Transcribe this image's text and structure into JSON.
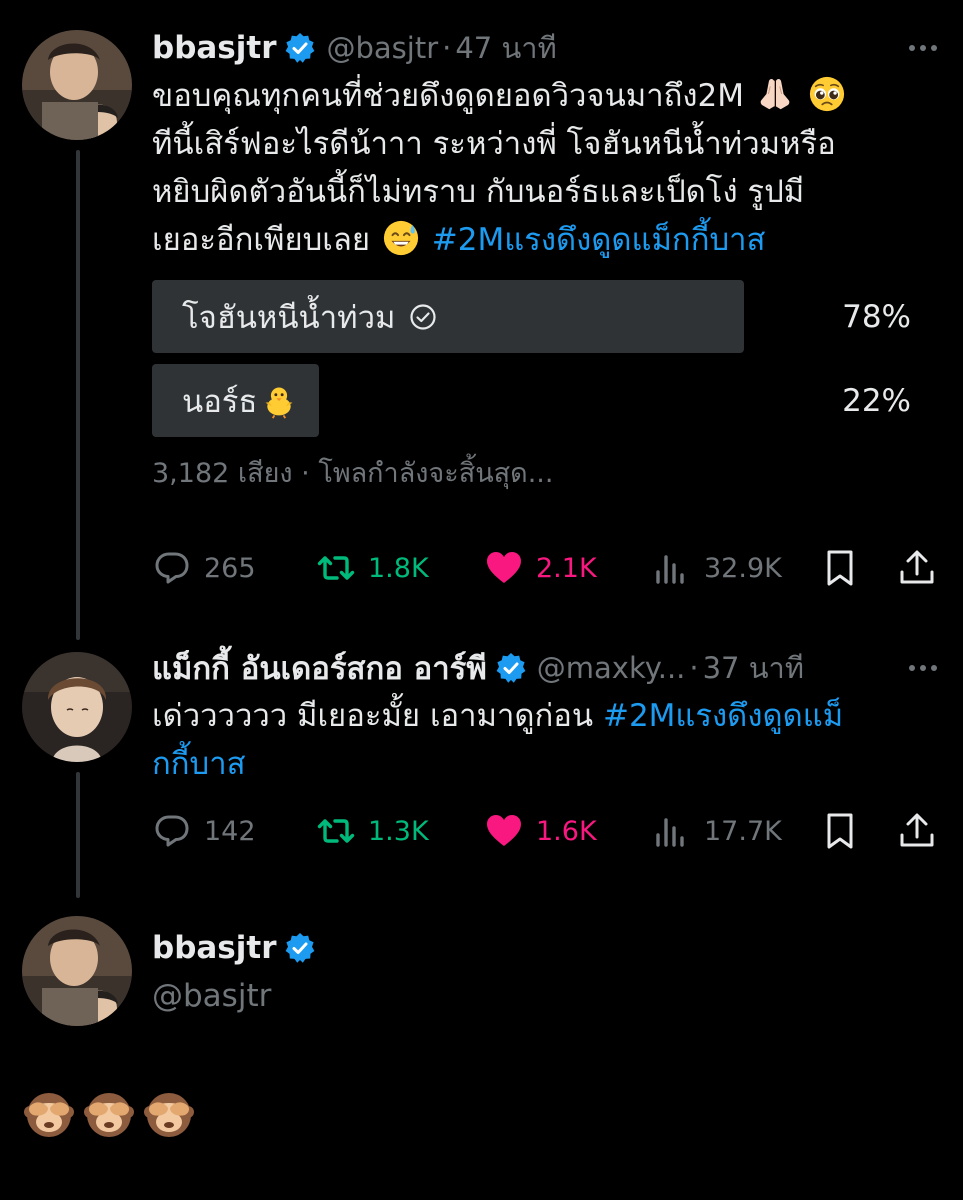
{
  "colors": {
    "background": "#000000",
    "text": "#e7e9ea",
    "muted": "#71767b",
    "link": "#1d9bf0",
    "retweet": "#00ba7c",
    "like": "#f91880",
    "poll_bar": "#2f3336"
  },
  "tweet1": {
    "name": "bbasjtr",
    "handle": "@basjtr",
    "separator": "·",
    "time": "47 นาที",
    "line1": "ขอบคุณทุกคนที่ช่วยดึงดูดยอดวิวจนมาถึง2M",
    "line2": "ทีนี้เสิร์ฟอะไรดีน้าาา ระหว่างพี่ โจฮันหนีน้ำท่วมหรือ",
    "line3": "หยิบผิดตัวอันนี้ก็ไม่ทราบ กับนอร์ธและเป็ดโง่ รูปมี",
    "line4": "เยอะอีกเพียบเลย",
    "hashtag": "#2Mแรงดึงดูดแม็กกี้บาส",
    "emojis": [
      "folded-hands-icon",
      "pleading-face-icon",
      "sweat-smile-icon"
    ],
    "poll": {
      "options": [
        {
          "label": "โจฮันหนีน้ำท่วม",
          "percent": "78%",
          "fraction": 0.78,
          "winner": true,
          "icon": "check-circle-icon"
        },
        {
          "label": "นอร์ธ",
          "percent": "22%",
          "fraction": 0.22,
          "winner": false,
          "icon": "baby-chick-icon"
        }
      ],
      "meta": "3,182 เสียง · โพลกำลังจะสิ้นสุด..."
    },
    "stats": {
      "replies": "265",
      "retweets": "1.8K",
      "likes": "2.1K",
      "views": "32.9K"
    }
  },
  "tweet2": {
    "name": "แม็กกี้ อันเดอร์สกอ อาร์พี",
    "handle": "@maxky...",
    "separator": "·",
    "time": "37 นาที",
    "line1_text": "เด่วววววว มีเยอะมั้ย เอามาดูก่อน ",
    "line1_hashtag": "#2Mแรงดึงดูดแม็",
    "line2_hashtag": "กกี้บาส",
    "stats": {
      "replies": "142",
      "retweets": "1.3K",
      "likes": "1.6K",
      "views": "17.7K"
    }
  },
  "tweet3": {
    "name": "bbasjtr",
    "handle": "@basjtr",
    "emojis": [
      "see-no-evil-monkey-icon",
      "see-no-evil-monkey-icon",
      "see-no-evil-monkey-icon"
    ]
  }
}
